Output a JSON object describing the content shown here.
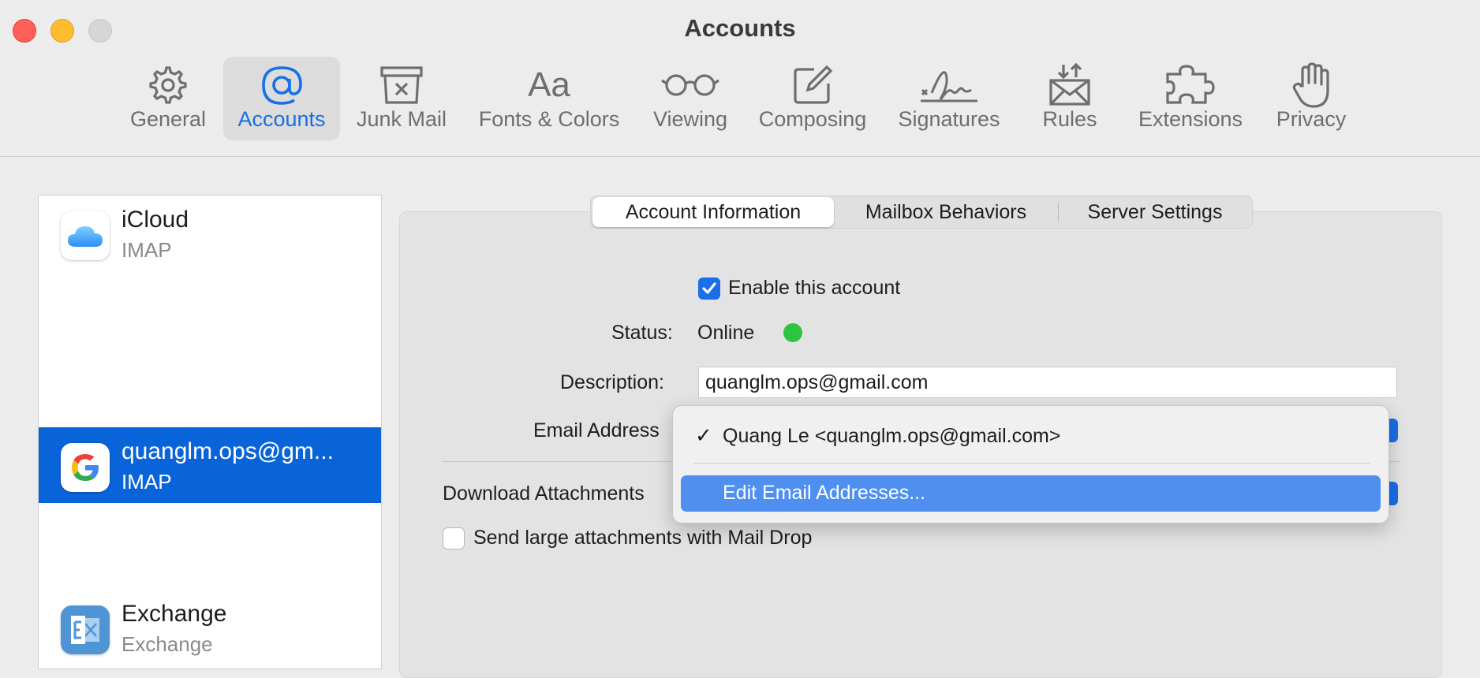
{
  "window": {
    "title": "Accounts"
  },
  "toolbar": {
    "items": [
      {
        "label": "General",
        "icon": "gear-icon"
      },
      {
        "label": "Accounts",
        "icon": "at-sign-icon",
        "active": true
      },
      {
        "label": "Junk Mail",
        "icon": "junk-bin-icon"
      },
      {
        "label": "Fonts & Colors",
        "icon": "fonts-aa-icon",
        "glyph": "Aa"
      },
      {
        "label": "Viewing",
        "icon": "glasses-icon"
      },
      {
        "label": "Composing",
        "icon": "compose-icon"
      },
      {
        "label": "Signatures",
        "icon": "signature-icon"
      },
      {
        "label": "Rules",
        "icon": "rules-envelope-icon"
      },
      {
        "label": "Extensions",
        "icon": "puzzle-icon"
      },
      {
        "label": "Privacy",
        "icon": "hand-icon"
      }
    ]
  },
  "sidebar": {
    "accounts": [
      {
        "name": "iCloud",
        "type": "IMAP",
        "icon": "icloud-icon"
      },
      {
        "name": "quanglm.ops@gm...",
        "type": "IMAP",
        "icon": "google-icon",
        "selected": true
      },
      {
        "name": "Exchange",
        "type": "Exchange",
        "icon": "exchange-icon"
      }
    ]
  },
  "tabs": {
    "items": [
      {
        "label": "Account Information",
        "active": true
      },
      {
        "label": "Mailbox Behaviors"
      },
      {
        "label": "Server Settings"
      }
    ]
  },
  "form": {
    "enable_label": "Enable this account",
    "enable_checked": true,
    "status_label": "Status:",
    "status_value": "Online",
    "status_color": "#2fc43f",
    "description_label": "Description:",
    "description_value": "quanglm.ops@gmail.com",
    "email_label": "Email Address",
    "download_label": "Download Attachments",
    "maildrop_label": "Send large attachments with Mail Drop",
    "maildrop_checked": false
  },
  "email_menu": {
    "items": [
      {
        "label": "Quang Le <quanglm.ops@gmail.com>",
        "checked": true,
        "check_glyph": "✓"
      },
      {
        "label": "Edit Email Addresses...",
        "highlighted": true
      }
    ]
  },
  "colors": {
    "accent": "#1a6ee8",
    "selection": "#0a64d9",
    "menu_highlight": "#4f8ff0"
  }
}
